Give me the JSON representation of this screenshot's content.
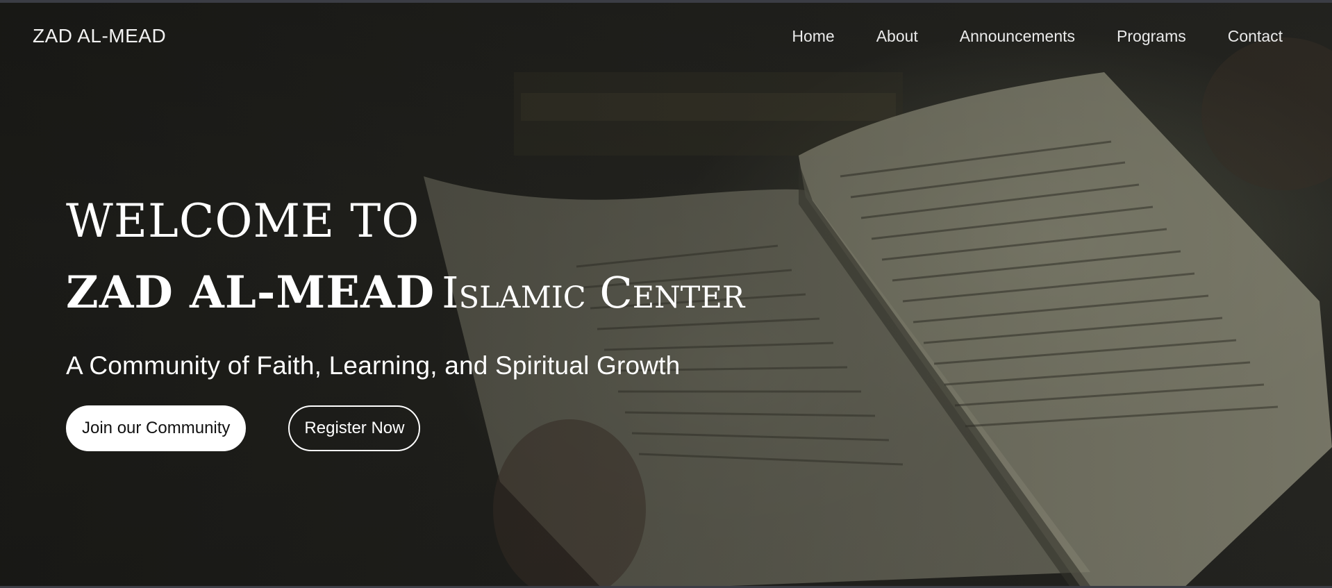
{
  "brand": {
    "name": "ZAD AL-MEAD"
  },
  "nav": {
    "links": [
      {
        "label": "Home"
      },
      {
        "label": "About"
      },
      {
        "label": "Announcements"
      },
      {
        "label": "Programs"
      },
      {
        "label": "Contact"
      }
    ]
  },
  "hero": {
    "welcome": "Welcome to",
    "name_bold": "ZAD AL-MEAD",
    "name_rest": "Islamic Center",
    "tagline": "A Community of Faith, Learning, and Spiritual Growth",
    "primary_cta": "Join our Community",
    "secondary_cta": "Register Now"
  },
  "colors": {
    "background": "#2a2a25",
    "text": "#ffffff",
    "button_primary_bg": "#ffffff",
    "button_primary_text": "#111111"
  }
}
